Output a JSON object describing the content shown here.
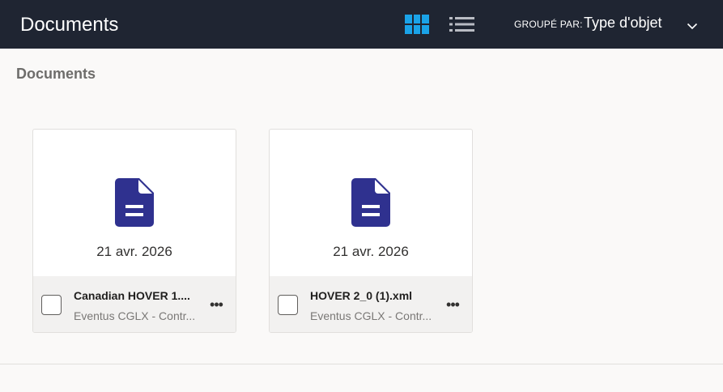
{
  "header": {
    "title": "Documents",
    "group_by_label": "GROUPÉ PAR:",
    "group_by_value": "Type d'objet",
    "grid_view_icon": "grid-view-icon",
    "list_view_icon": "list-view-icon",
    "accent_color": "#1aa3e8",
    "background_color": "#1f2532"
  },
  "section": {
    "title": "Documents"
  },
  "documents": [
    {
      "date": "21 avr. 2026",
      "name": "Canadian HOVER 1....",
      "subtitle": "Eventus CGLX - Contr...",
      "icon": "document-icon",
      "icon_color": "#2f318f"
    },
    {
      "date": "21 avr. 2026",
      "name": "HOVER 2_0 (1).xml",
      "subtitle": "Eventus CGLX - Contr...",
      "icon": "document-icon",
      "icon_color": "#2f318f"
    }
  ]
}
